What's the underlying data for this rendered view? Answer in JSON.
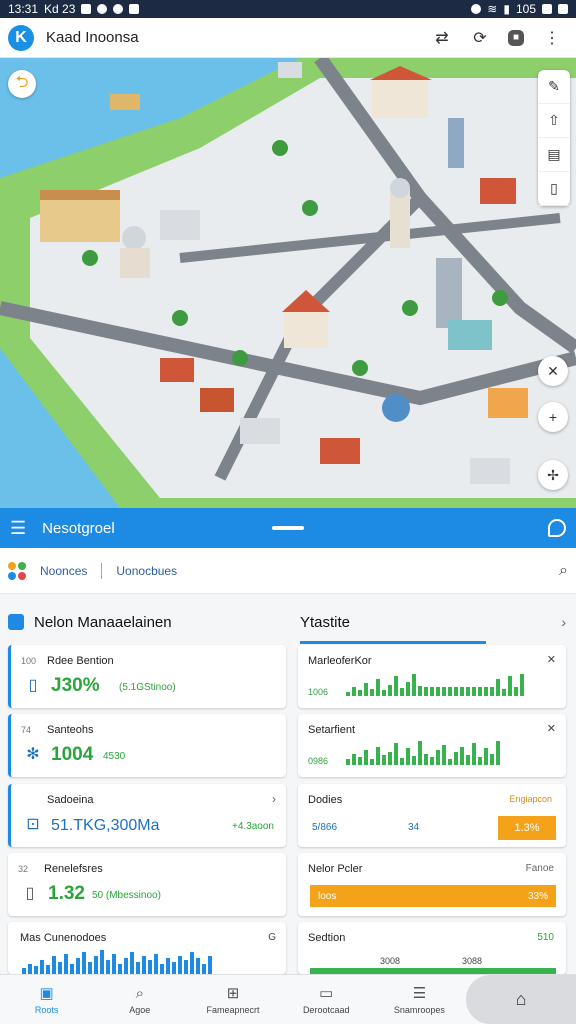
{
  "status_bar": {
    "time": "13:31",
    "carrier": "Kd 23",
    "battery": "105"
  },
  "app_bar": {
    "logo": "K",
    "title": "Kaad Inoonsa",
    "actions": [
      "sync-icon",
      "refresh-icon",
      "stop-icon",
      "more-vert-icon"
    ]
  },
  "map": {
    "back_icon": "back-arrow-icon",
    "tools": [
      "edit-icon",
      "upload-icon",
      "document-icon",
      "book-icon"
    ],
    "controls": [
      "close-icon",
      "plus-icon",
      "compass-icon"
    ]
  },
  "nav_bar": {
    "label": "Nesotgroel"
  },
  "filters": {
    "items": [
      "Noonces",
      "Uonocbues"
    ]
  },
  "section_left": {
    "title": "Nelon Manaaelainen"
  },
  "section_right": {
    "title": "Ytastite"
  },
  "left_cards": [
    {
      "num": "100",
      "title": "Rdee Bention",
      "value": "J30%",
      "sub": "(5.1GStinoo)"
    },
    {
      "num": "74",
      "title": "Santeohs",
      "value": "1004",
      "sub": "4530"
    },
    {
      "num": "",
      "title": "Sadoeina",
      "value": "51.TKG,300Ma",
      "right": "+4.3aoon"
    },
    {
      "num": "32",
      "title": "Renelefsres",
      "value": "1.32",
      "sub": "50 (Mbessinoo)"
    },
    {
      "num": "",
      "title": "Mas Cunenodoes",
      "right": "G"
    }
  ],
  "right_cards": [
    {
      "title": "MarleoferKor",
      "label": "1006",
      "bars": [
        4,
        10,
        6,
        14,
        8,
        18,
        6,
        12,
        22,
        9,
        15,
        24,
        11,
        10,
        10,
        10,
        10,
        10,
        10,
        10,
        10,
        10,
        10,
        10,
        10,
        18,
        8,
        22,
        10,
        24
      ]
    },
    {
      "title": "Setarfient",
      "label": "0986",
      "bars": [
        6,
        12,
        9,
        16,
        7,
        20,
        11,
        14,
        24,
        8,
        18,
        10,
        26,
        12,
        9,
        16,
        22,
        7,
        14,
        20,
        11,
        24,
        9,
        18,
        12,
        26
      ]
    },
    {
      "title": "Dodies",
      "left": "5/866",
      "mid": "34",
      "badge_top": "Engiapcon",
      "badge": "1.3%"
    },
    {
      "title": "Nelor Pcler",
      "right_label": "Fanoe",
      "bar_label": "loos",
      "bar_right": "33%"
    },
    {
      "title": "Sedtion",
      "right_label": "510",
      "mid_labels": [
        "3008",
        "3088"
      ]
    }
  ],
  "bottom_nav": [
    {
      "icon": "home-icon",
      "label": "Roots",
      "active": true
    },
    {
      "icon": "search-icon",
      "label": "Agoe"
    },
    {
      "icon": "grid-icon",
      "label": "Fameapnecrt"
    },
    {
      "icon": "folder-icon",
      "label": "Derootcaad"
    },
    {
      "icon": "list-icon",
      "label": "Snamroopes"
    }
  ],
  "colors": {
    "primary": "#1d8ae3",
    "green": "#37b24d",
    "orange": "#f5a21b",
    "water": "#6bc0ea"
  }
}
